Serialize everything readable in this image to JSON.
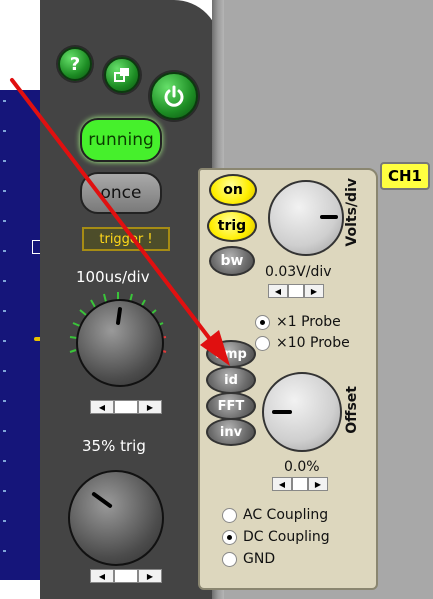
{
  "icons": {
    "help": "?",
    "window": "window-icon",
    "power": "power-icon"
  },
  "acquisition": {
    "running_label": "running",
    "once_label": "once",
    "trigger_status": "trigger !"
  },
  "timebase": {
    "label": "100us/div"
  },
  "trigger_level": {
    "label": "35% trig"
  },
  "channel": {
    "tab_label": "CH1",
    "buttons": {
      "on": "on",
      "trig": "trig",
      "bw": "bw",
      "amp": "amp",
      "id": "id",
      "fft": "FFT",
      "inv": "inv"
    },
    "volts_per_div": {
      "axis_label": "Volts/div",
      "value": "0.03V/div"
    },
    "probe": {
      "options": [
        "×1  Probe",
        "×10 Probe"
      ],
      "selected": 0
    },
    "offset": {
      "axis_label": "Offset",
      "value": "0.0%"
    },
    "coupling": {
      "options": [
        "AC Coupling",
        "DC Coupling",
        "GND"
      ],
      "selected": 1
    }
  },
  "colors": {
    "running_green": "#46f02c",
    "panel_beige": "#ddd7be",
    "tab_yellow": "#ffff40",
    "arrow_red": "#e01010"
  }
}
